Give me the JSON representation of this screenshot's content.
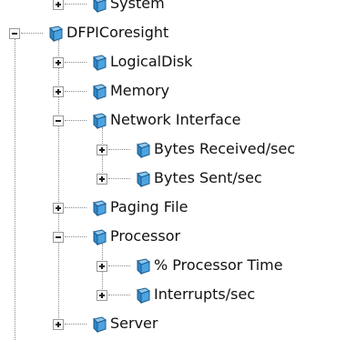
{
  "colors": {
    "icon_fill": "#2f86c6",
    "icon_stroke": "#1e5c8d",
    "icon_top": "#8ec8f0",
    "connector": "#8a8a8a",
    "text": "#111111"
  },
  "tree": [
    {
      "label": "System",
      "level": 1,
      "state": "collapsed",
      "icon": "cube-icon",
      "partial": true
    },
    {
      "label": "DFPICoresight",
      "level": 0,
      "state": "expanded",
      "icon": "cube-icon"
    },
    {
      "label": "LogicalDisk",
      "level": 1,
      "state": "collapsed",
      "icon": "cube-icon"
    },
    {
      "label": "Memory",
      "level": 1,
      "state": "collapsed",
      "icon": "cube-icon"
    },
    {
      "label": "Network Interface",
      "level": 1,
      "state": "expanded",
      "icon": "cube-icon"
    },
    {
      "label": "Bytes Received/sec",
      "level": 2,
      "state": "collapsed",
      "icon": "cube-icon"
    },
    {
      "label": "Bytes Sent/sec",
      "level": 2,
      "state": "collapsed",
      "icon": "cube-icon"
    },
    {
      "label": "Paging File",
      "level": 1,
      "state": "collapsed",
      "icon": "cube-icon"
    },
    {
      "label": "Processor",
      "level": 1,
      "state": "expanded",
      "icon": "cube-icon"
    },
    {
      "label": "% Processor Time",
      "level": 2,
      "state": "collapsed",
      "icon": "cube-icon"
    },
    {
      "label": "Interrupts/sec",
      "level": 2,
      "state": "collapsed",
      "icon": "cube-icon"
    },
    {
      "label": "Server",
      "level": 1,
      "state": "collapsed",
      "icon": "cube-icon"
    }
  ]
}
